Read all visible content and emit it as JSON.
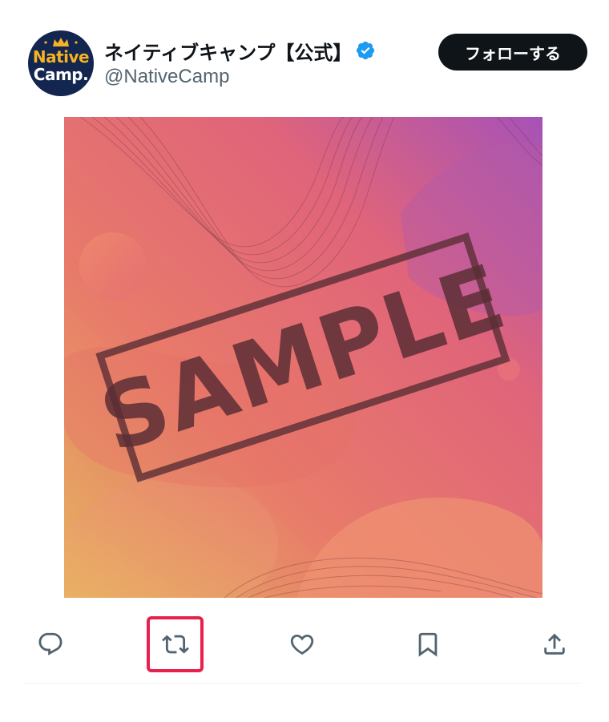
{
  "account": {
    "display_name": "ネイティブキャンプ【公式】",
    "handle": "@NativeCamp",
    "verified": true,
    "avatar": {
      "logo_line1": "Native",
      "logo_line2": "Camp.",
      "icon": "crown-icon",
      "bg_color": "#13264f",
      "accent_color": "#f5b324"
    }
  },
  "follow_button": {
    "label": "フォローする"
  },
  "media": {
    "stamp_text": "SAMPLE",
    "icon": "sample-image"
  },
  "actions": [
    {
      "name": "reply",
      "icon": "reply-icon"
    },
    {
      "name": "retweet",
      "icon": "retweet-icon",
      "highlighted": true
    },
    {
      "name": "like",
      "icon": "heart-icon"
    },
    {
      "name": "bookmark",
      "icon": "bookmark-icon"
    },
    {
      "name": "share",
      "icon": "share-icon"
    }
  ],
  "colors": {
    "text_primary": "#0f1419",
    "text_secondary": "#536471",
    "verified_blue": "#1d9bf0",
    "highlight_red": "#e8204e",
    "icon_gray": "#536471"
  }
}
